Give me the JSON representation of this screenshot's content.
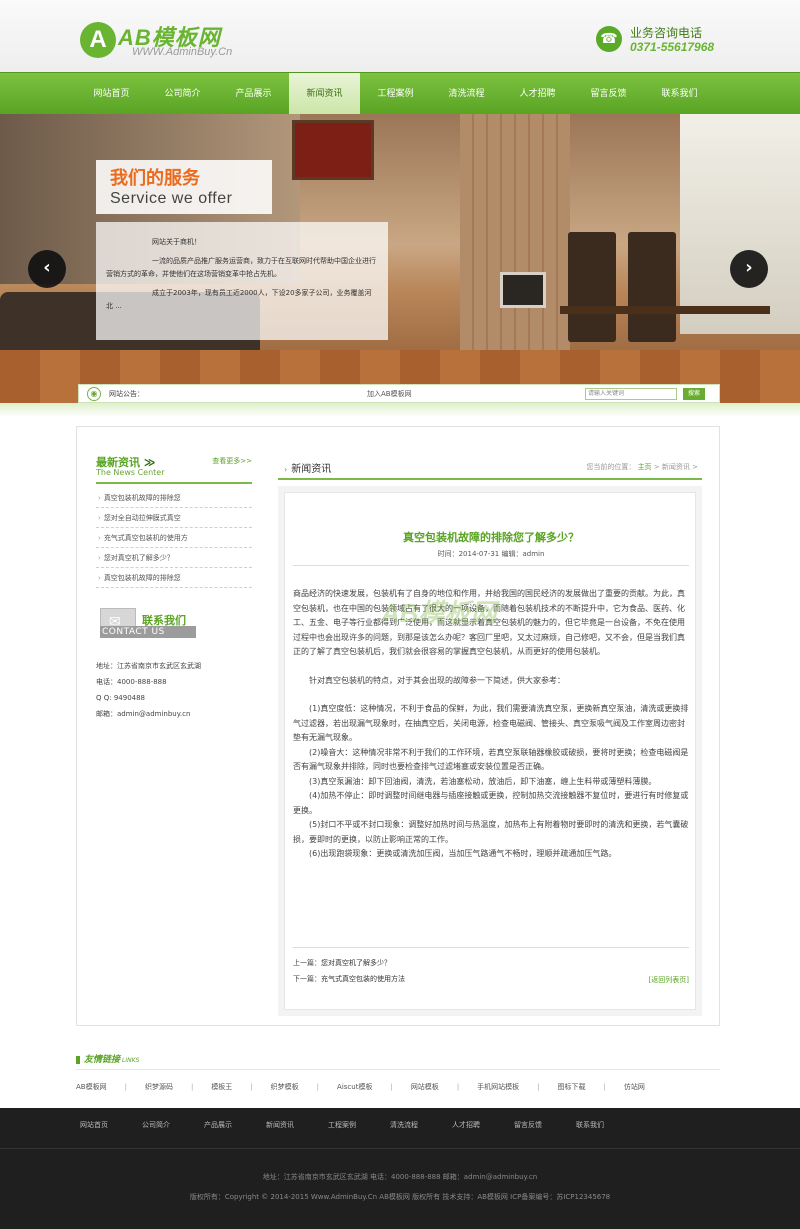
{
  "header": {
    "logo_letter": "A",
    "logo_name": "AB模板网",
    "logo_url": "WWW.AdminBuy.Cn",
    "hotline_label": "业务咨询电话",
    "hotline_number": "0371-55617968"
  },
  "nav": {
    "items": [
      "网站首页",
      "公司简介",
      "产品展示",
      "新闻资讯",
      "工程案例",
      "清洗流程",
      "人才招聘",
      "留言反馈",
      "联系我们"
    ],
    "active_index": 3
  },
  "banner": {
    "service_title_zh": "我们的服务",
    "service_title_en": "Service we offer",
    "service_greeting": "网站关于商机！",
    "service_para1": "一流的品质产品推广服务运营商，致力于在互联网时代帮助中国企业进行营销方式的革命，并使他们在这场营销变革中抢占先机。",
    "service_para2": "成立于2003年，现有员工近2000人，下设20多家子公司，业务覆盖河北 ...",
    "prev_arrow": "‹",
    "next_arrow": "›"
  },
  "notice": {
    "label": "网站公告：",
    "text": "加入AB模板网",
    "search_placeholder": "请输入关键词",
    "search_button": "搜索"
  },
  "sidebar": {
    "news_title": "最新资讯",
    "news_title_en": "The News Center",
    "more": "查看更多>>",
    "news_items": [
      "真空包装机故障的排除您",
      "您对全自动拉伸膜式真空",
      "充气式真空包装机的使用方",
      "您对真空机了解多少？",
      "真空包装机故障的排除您"
    ],
    "contact_title": "联系我们",
    "contact_title_en": "CONTACT US",
    "contact": {
      "address": "地址：江苏省南京市玄武区玄武湖",
      "phone": "电话：4000-888-888",
      "qq": "Q Q: 9490488",
      "email": "邮箱：admin@admin​buy.cn"
    }
  },
  "content": {
    "section_title": "新闻资讯",
    "breadcrumb_prefix": "您当前的位置：",
    "breadcrumb_home": "主页",
    "breadcrumb_current": "新闻资讯",
    "article_title": "真空包装机故障的排除您了解多少？",
    "article_meta": "时间：2014-07-31    编辑：admin",
    "watermark": "AB模板网",
    "paragraphs": [
      "商品经济的快速发展，包装机有了自身的地位和作用，并给我国的国民经济的发展做出了重要的贡献。为此，真空包装机，也在中国的包装领域占有了很大的一项设备，而随着包装机技术的不断提升中，它为食品、医药、化工、五金、电子等行业都得到广泛使用，而这就显示着真空包装机的魅力的，但它毕竟是一台设备，不免在使用过程中也会出现许多的问题，到那是该怎么办呢？客回厂里吧，又太过麻烦，自己修吧，又不会，但是当我们真正的了解了真空包装机后，我们就会很容易的掌握真空包装机，从而更好的使用包装机。",
      "针对真空包装机的特点，对于其会出现的故障参一下简述，供大家参考：",
      "(1)真空度低：这种情况，不利于食品的保鲜，为此，我们需要清洗真空泵，更换新真空泵油，清洗或更换排气过滤器，若出现漏气现象时，在抽真空后，关闭电源，检查电磁阀、管接头、真空泵吸气阀及工作室周边密封垫有无漏气现象。",
      "(2)噪音大：这种情况非常不利于我们的工作环境，若真空泵联轴器橡胶或破损，要将时更换；检查电磁阀是否有漏气现象并排除，同时也要检查排气过滤堵塞或安装位置是否正确。",
      "(3)真空泵漏油：卸下回油阀，清洗，若油塞松动，放油后，卸下油塞，缠上生料带或薄塑料薄膜。",
      "(4)加热不停止：即时调整时间继电器与插座接触或更换，控制加热交流接触器不复位时，要进行有时修复或更换。",
      "(5)封口不平或不封口现象：调整好加热时间与热温度，加热布上有附着物时要即时的清洗和更换，若气囊破损，要即时的更换，以防止影响正常的工作。",
      "(6)出现跑袋现象：更换或清洗加压阀，当加压气路通气不畅时，理顺并疏通加压气路。"
    ],
    "prev_label": "上一篇：",
    "prev_title": "您对真空机了解多少？",
    "next_label": "下一篇：",
    "next_title": "充气式真空包装的使用方法",
    "back_label": "[返回列表页]"
  },
  "links": {
    "title": "友情链接",
    "title_en": "LINKS",
    "items": [
      "AB模板网",
      "织梦源码",
      "模板王",
      "织梦模板",
      "Aiscut模板",
      "网站模板",
      "手机网站模板",
      "图标下载",
      "仿站网"
    ]
  },
  "footer": {
    "nav": [
      "网站首页",
      "公司简介",
      "产品展示",
      "新闻资讯",
      "工程案例",
      "清洗流程",
      "人才招聘",
      "留言反馈",
      "联系我们"
    ],
    "address_line": "地址：江苏省南京市玄武区玄武湖     电话：4000-888-888     邮箱：admin@adminbuy.cn",
    "copyright_line": "版权所有：Copyright © 2014-2015 Www.AdminBuy.Cn  AB模板网 版权所有    技术支持：AB模板网    ICP备案编号：苏ICP12345678"
  }
}
